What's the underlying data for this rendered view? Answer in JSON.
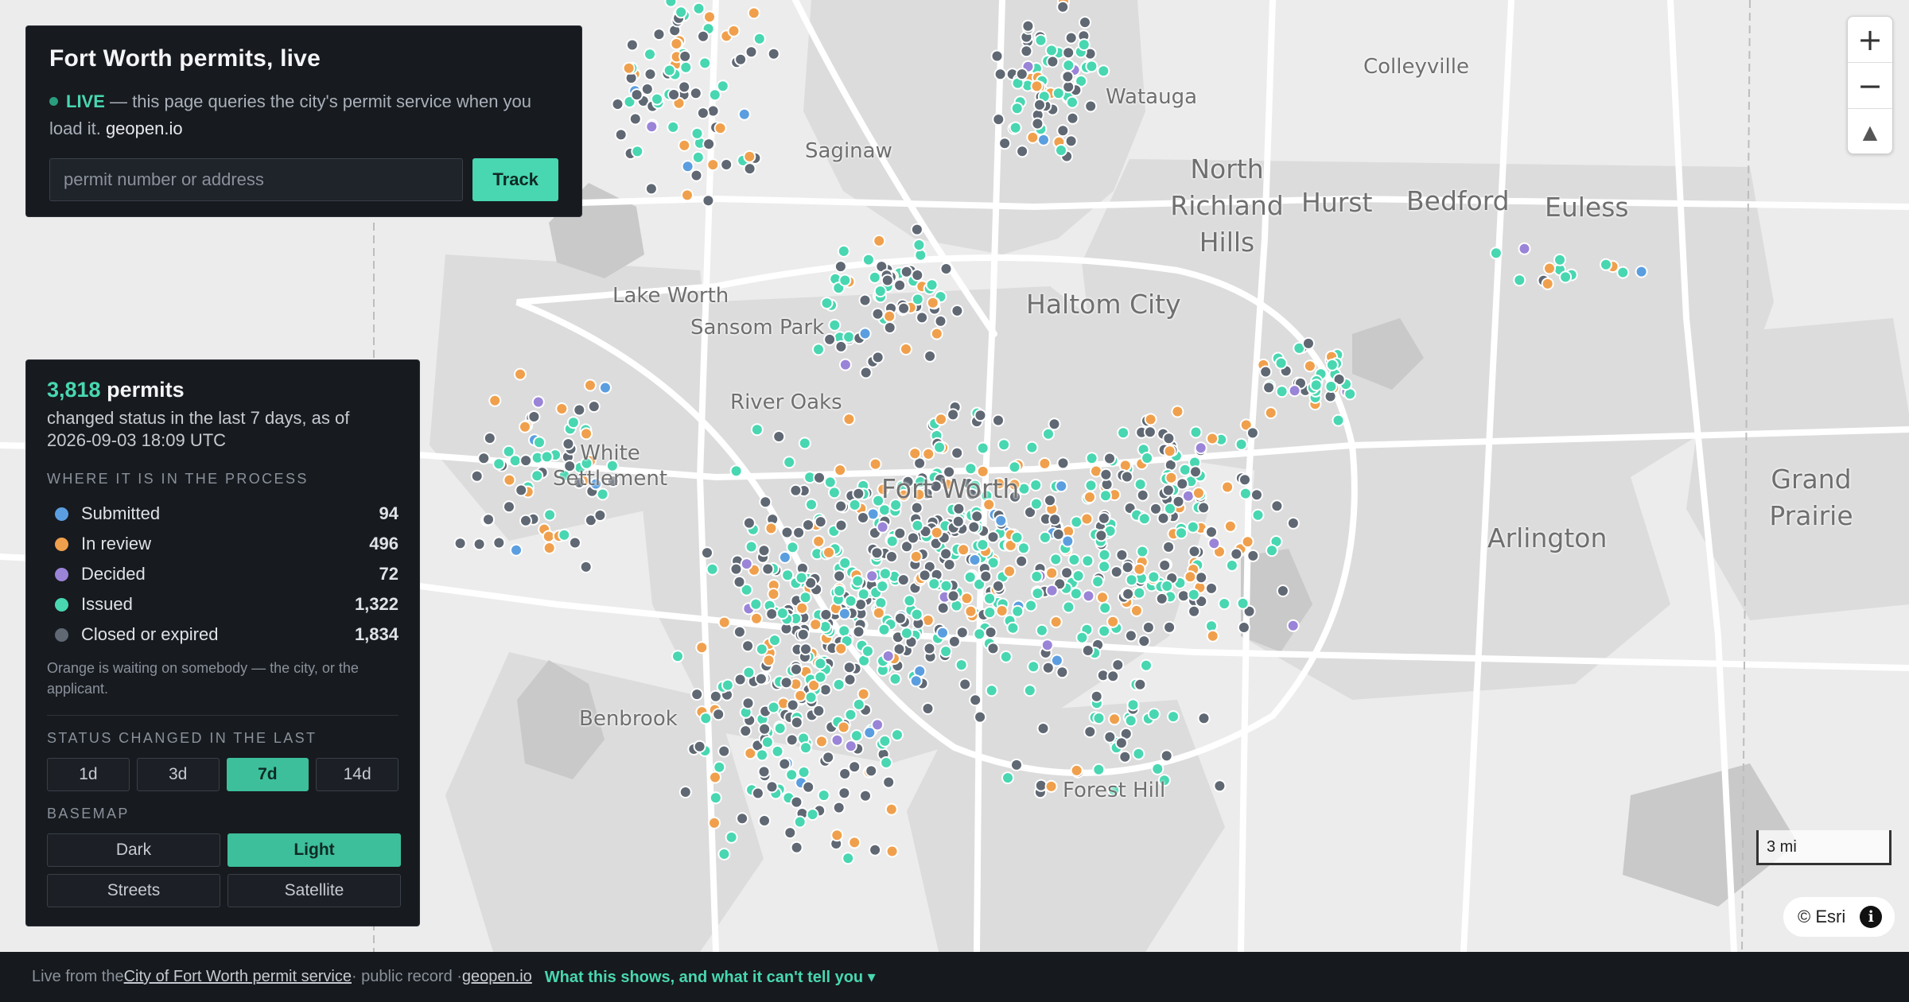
{
  "header": {
    "title": "Fort Worth permits, live",
    "live_label": "LIVE",
    "live_text": " — this page queries the city's permit service when you load it. ",
    "brand": "geopen.io"
  },
  "search": {
    "placeholder": "permit number or address",
    "button_label": "Track"
  },
  "summary": {
    "count": "3,818",
    "count_unit": " permits",
    "as_of_text": "changed status in the last 7 days, as of 2026-09-03 18:09 UTC"
  },
  "process": {
    "label": "WHERE IT IS IN THE PROCESS",
    "items": [
      {
        "label": "Submitted",
        "value": "94",
        "color": "#5b9ee0"
      },
      {
        "label": "In review",
        "value": "496",
        "color": "#f0a04c"
      },
      {
        "label": "Decided",
        "value": "72",
        "color": "#9a84d8"
      },
      {
        "label": "Issued",
        "value": "1,322",
        "color": "#48d7b1"
      },
      {
        "label": "Closed or expired",
        "value": "1,834",
        "color": "#5f6873"
      }
    ],
    "note": "Orange is waiting on somebody — the city, or the applicant."
  },
  "time_filter": {
    "label": "STATUS CHANGED IN THE LAST",
    "options": [
      "1d",
      "3d",
      "7d",
      "14d"
    ],
    "selected": "7d"
  },
  "basemap": {
    "label": "BASEMAP",
    "options": [
      "Dark",
      "Light",
      "Streets",
      "Satellite"
    ],
    "selected": "Light"
  },
  "map": {
    "places": [
      "Colleyville",
      "Watauga",
      "Saginaw",
      "North Richland Hills",
      "Hurst",
      "Bedford",
      "Euless",
      "Lake Worth",
      "Sansom Park",
      "Haltom City",
      "River Oaks",
      "White Settlement",
      "Fort Worth",
      "Grand Prairie",
      "Arlington",
      "Benbrook",
      "Forest Hill"
    ],
    "zoom_in": "+",
    "zoom_out": "−",
    "compass": "▲",
    "scale_label": "3 mi",
    "attribution": "© Esri",
    "info_icon": "i"
  },
  "footer": {
    "prefix": "Live from the ",
    "source_link": "City of Fort Worth permit service",
    "middle": " · public record · ",
    "brand_link": "geopen.io",
    "cta": "What this shows, and what it can't tell you ▾"
  }
}
